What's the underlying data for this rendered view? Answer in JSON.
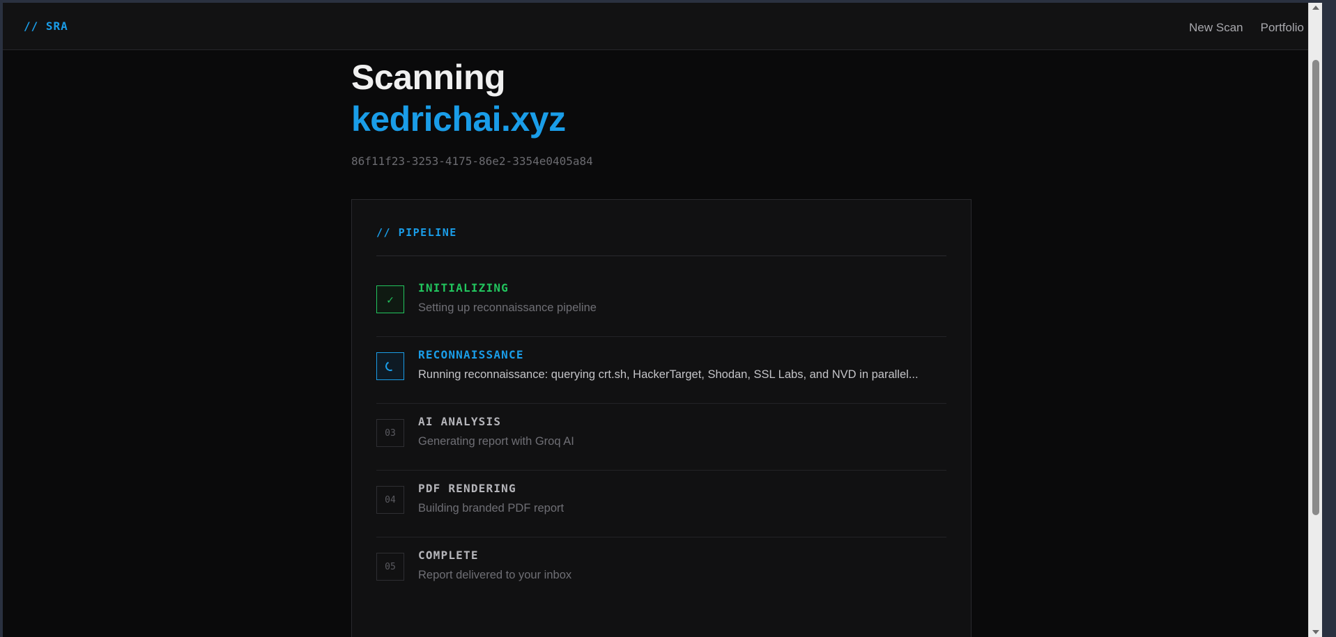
{
  "app": {
    "logo": "// SRA"
  },
  "nav": {
    "new_scan": "New Scan",
    "portfolio": "Portfolio"
  },
  "page": {
    "heading": "Scanning",
    "domain": "kedrichai.xyz",
    "scan_id": "86f11f23-3253-4175-86e2-3354e0405a84"
  },
  "pipeline": {
    "header": "// PIPELINE",
    "steps": [
      {
        "badge": "✓",
        "status": "done",
        "title": "INITIALIZING",
        "desc": "Setting up reconnaissance pipeline"
      },
      {
        "badge": "",
        "status": "active",
        "title": "RECONNAISSANCE",
        "desc": "Running reconnaissance: querying crt.sh, HackerTarget, Shodan, SSL Labs, and NVD in parallel..."
      },
      {
        "badge": "03",
        "status": "pending",
        "title": "AI ANALYSIS",
        "desc": "Generating report with Groq AI"
      },
      {
        "badge": "04",
        "status": "pending",
        "title": "PDF RENDERING",
        "desc": "Building branded PDF report"
      },
      {
        "badge": "05",
        "status": "pending",
        "title": "COMPLETE",
        "desc": "Report delivered to your inbox"
      }
    ]
  },
  "colors": {
    "accent": "#1a9de8",
    "success": "#22c55e",
    "background": "#0a0a0b"
  }
}
